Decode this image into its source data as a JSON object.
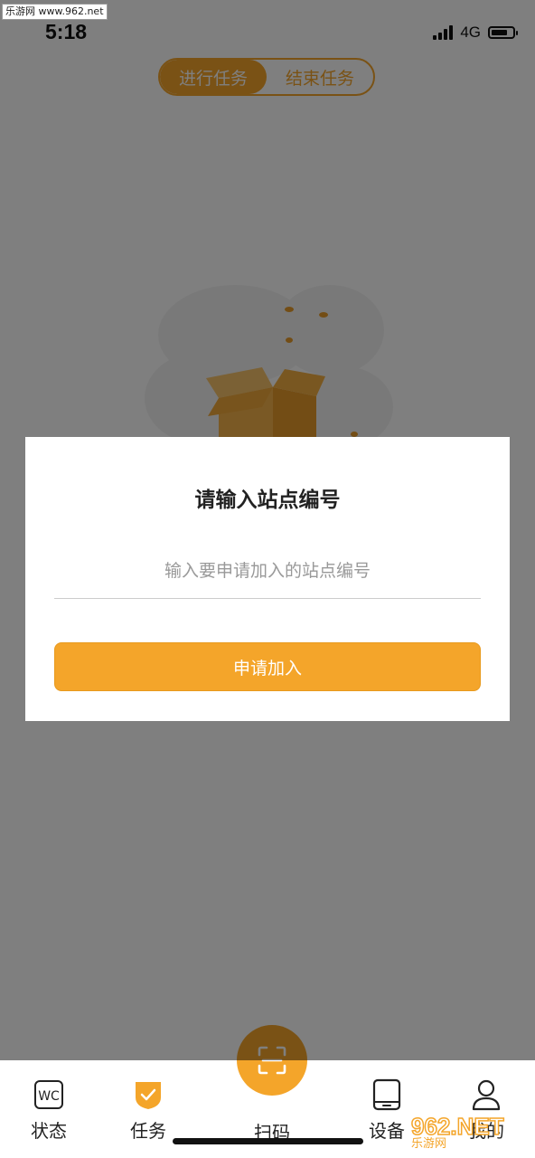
{
  "watermark_top": "乐游网 www.962.net",
  "status_bar": {
    "time": "5:18",
    "network": "4G"
  },
  "segment": {
    "tabs": [
      {
        "label": "进行任务",
        "active": true
      },
      {
        "label": "结束任务",
        "active": false
      }
    ]
  },
  "dialog": {
    "title": "请输入站点编号",
    "input_placeholder": "输入要申请加入的站点编号",
    "input_value": "",
    "button_label": "申请加入"
  },
  "tab_bar": {
    "items": [
      {
        "label": "状态",
        "icon": "wc-icon"
      },
      {
        "label": "任务",
        "icon": "shield-check-icon",
        "active": true
      },
      {
        "label": "扫码",
        "icon": "scan-icon"
      },
      {
        "label": "设备",
        "icon": "tablet-icon"
      },
      {
        "label": "我的",
        "icon": "person-icon"
      }
    ]
  },
  "watermark_br": {
    "big": "962.NET",
    "small": "乐游网"
  },
  "colors": {
    "accent": "#f4a52a",
    "overlay": "rgba(0,0,0,0.5)"
  }
}
